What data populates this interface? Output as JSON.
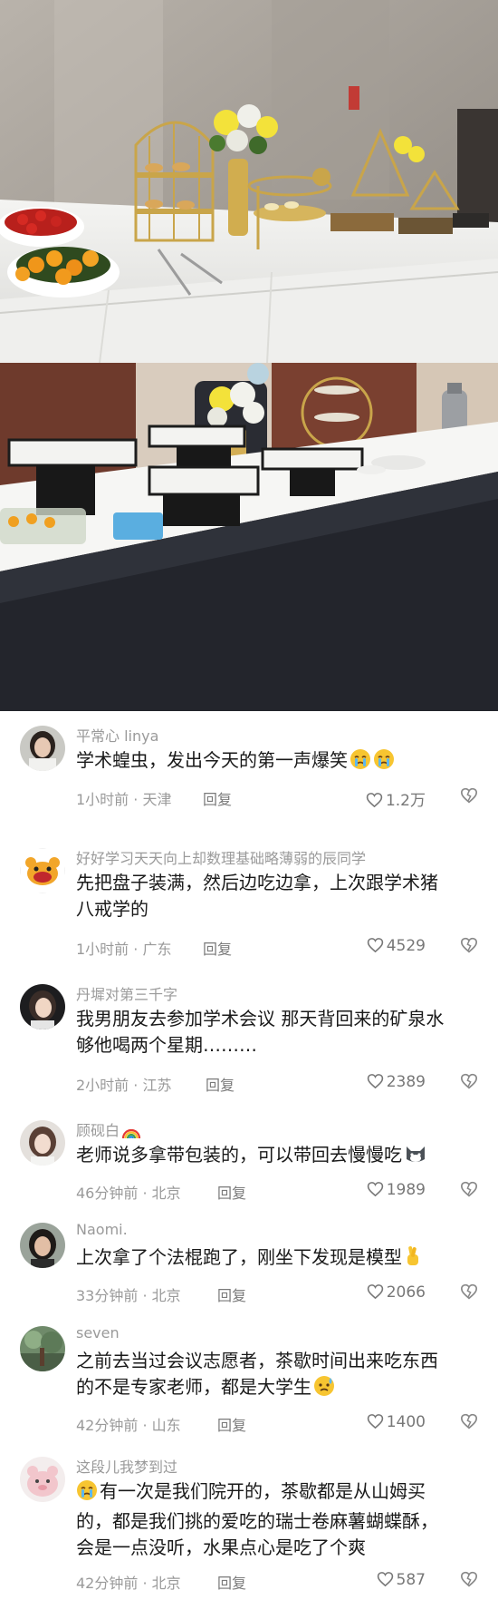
{
  "comments": [
    {
      "user": "平常心 linya",
      "lines": [
        "学术蝗虫，发出今天的第一声爆笑"
      ],
      "emoji": "crying-face-icon",
      "time": "1小时前 · 天津",
      "reply": "回复",
      "likes": "1.2万"
    },
    {
      "user": "好好学习天天向上却数理基础略薄弱的辰同学",
      "lines": [
        "先把盘子装满，然后边吃边拿，上次跟学术猪",
        "八戒学的"
      ],
      "time": "1小时前 · 广东",
      "reply": "回复",
      "likes": "4529"
    },
    {
      "user": "丹墀对第三千字",
      "lines": [
        "我男朋友去参加学术会议 那天背回来的矿泉水",
        "够他喝两个星期………"
      ],
      "time": "2小时前 · 江苏",
      "reply": "回复",
      "likes": "2389"
    },
    {
      "user": "顾砚白",
      "user_emoji": "rainbow-icon",
      "lines": [
        "老师说多拿带包装的，可以带回去慢慢吃"
      ],
      "emoji": "cat-face-icon",
      "time": "46分钟前 · 北京",
      "reply": "回复",
      "likes": "1989"
    },
    {
      "user": "Naomi.",
      "lines": [
        "上次拿了个法棍跑了，刚坐下发现是模型"
      ],
      "emoji": "crossed-fingers-icon",
      "time": "33分钟前 · 北京",
      "reply": "回复",
      "likes": "2066"
    },
    {
      "user": "seven",
      "lines": [
        "之前去当过会议志愿者，茶歇时间出来吃东西",
        "的不是专家老师，都是大学生"
      ],
      "emoji": "sweat-face-icon",
      "time": "42分钟前 · 山东",
      "reply": "回复",
      "likes": "1400"
    },
    {
      "user": "这段儿我梦到过",
      "lead_emoji": "crying-face-icon",
      "lines": [
        "有一次是我们院开的，茶歇都是从山姆买",
        "的，都是我们挑的爱吃的瑞士卷麻薯蝴蝶酥，",
        "会是一点没听，水果点心是吃了个爽"
      ],
      "time": "42分钟前 · 北京",
      "reply": "回复",
      "likes": "587"
    }
  ],
  "colors": {
    "text": "#1a1a1a",
    "meta": "#9a9a9a",
    "heart": "#777777"
  }
}
